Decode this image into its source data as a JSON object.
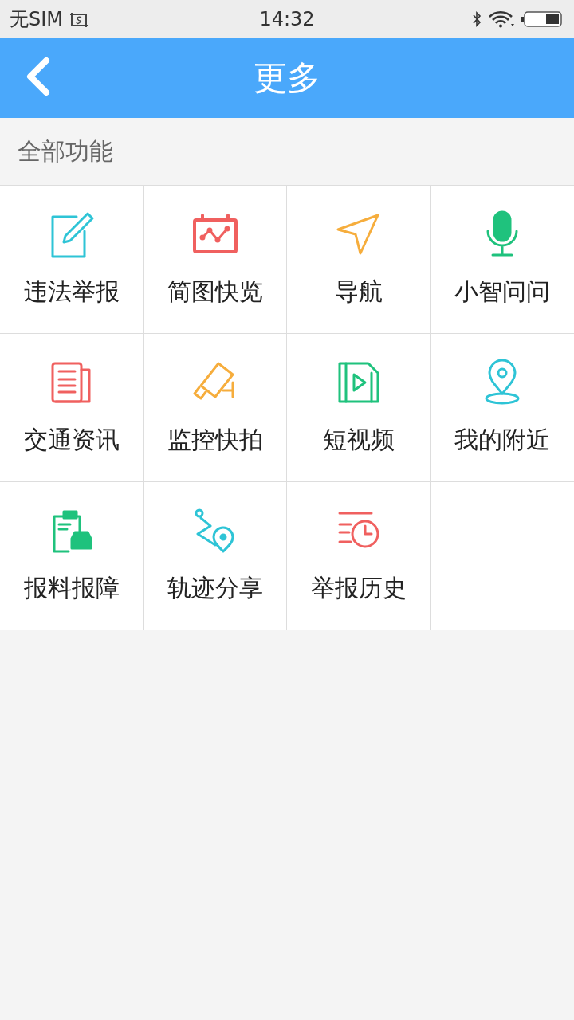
{
  "status_bar": {
    "carrier": "无SIM",
    "time": "14:32"
  },
  "header": {
    "title": "更多"
  },
  "section": {
    "title": "全部功能"
  },
  "features": [
    {
      "label": "违法举报",
      "color": "#2ec4d6"
    },
    {
      "label": "简图快览",
      "color": "#f0605f"
    },
    {
      "label": "导航",
      "color": "#f6ad3c"
    },
    {
      "label": "小智问问",
      "color": "#1fc27d"
    },
    {
      "label": "交通资讯",
      "color": "#f0605f"
    },
    {
      "label": "监控快拍",
      "color": "#f6ad3c"
    },
    {
      "label": "短视频",
      "color": "#1fc27d"
    },
    {
      "label": "我的附近",
      "color": "#2ec4d6"
    },
    {
      "label": "报料报障",
      "color": "#1fc27d"
    },
    {
      "label": "轨迹分享",
      "color": "#2ec4d6"
    },
    {
      "label": "举报历史",
      "color": "#f0605f"
    }
  ]
}
